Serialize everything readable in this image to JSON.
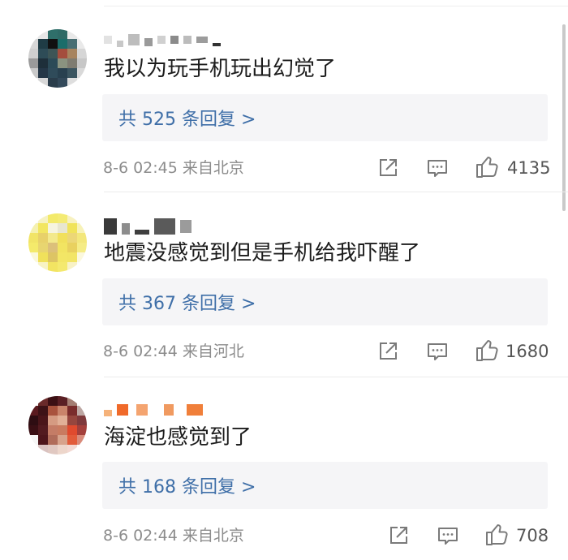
{
  "comments": [
    {
      "text": "我以为玩手机玩出幻觉了",
      "reply_summary": "共 525 条回复 >",
      "meta": "8-6 02:45  来自北京",
      "likes": "4135",
      "avatar_colors": [
        "#2f6f6a",
        "#486e73",
        "#1f3c45"
      ]
    },
    {
      "text": "地震没感觉到但是手机给我吓醒了",
      "reply_summary": "共 367 条回复 >",
      "meta": "8-6 02:44  来自河北",
      "likes": "1680",
      "avatar_colors": [
        "#f3ea6a",
        "#e8d16a",
        "#f5f1b0"
      ]
    },
    {
      "text": "海淀也感觉到了",
      "reply_summary": "共 168 条回复 >",
      "meta": "8-6 02:44  来自北京",
      "likes": "708",
      "avatar_colors": [
        "#5a1f24",
        "#a9533d",
        "#e04a2e"
      ]
    }
  ],
  "theme": {
    "reply_link_color": "#3f6fa8",
    "meta_color": "#8c8c8c",
    "reply_bg": "#f5f5f7"
  }
}
